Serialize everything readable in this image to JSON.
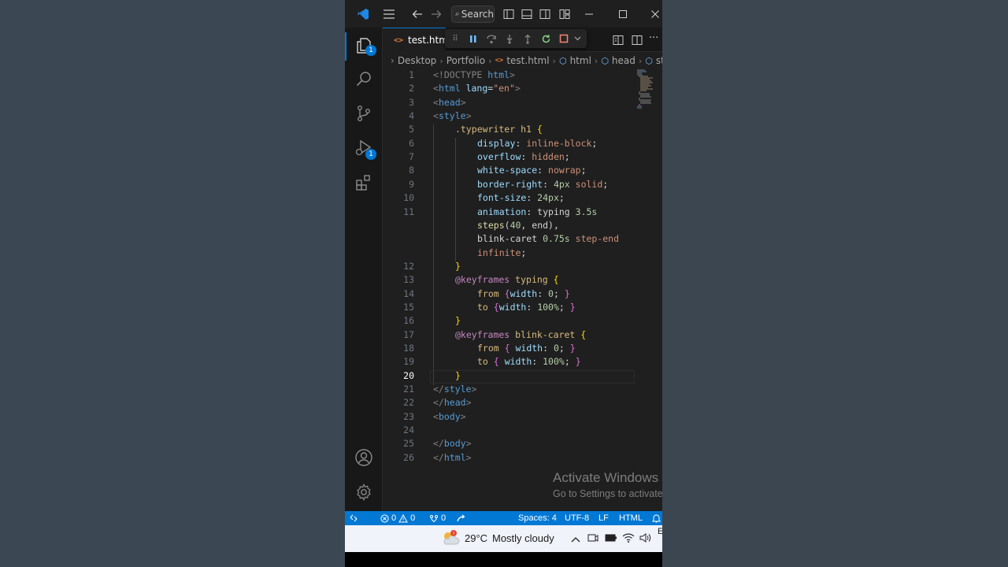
{
  "search": {
    "label": "Search"
  },
  "tab": {
    "title": "test.html"
  },
  "breadcrumb": [
    "Desktop",
    "Portfolio",
    "test.html",
    "html",
    "head",
    "style"
  ],
  "badges": {
    "explorer": "1",
    "debug": "1"
  },
  "editor": {
    "active_line": 20,
    "lines": [
      {
        "n": "1",
        "ind": 0,
        "tokens": [
          [
            "t-tag",
            "<!DOCTYPE "
          ],
          [
            "t-name",
            "html"
          ],
          [
            "t-tag",
            ">"
          ]
        ]
      },
      {
        "n": "2",
        "ind": 0,
        "tokens": [
          [
            "t-tag",
            "<"
          ],
          [
            "t-name",
            "html"
          ],
          [
            "t-attr",
            " lang"
          ],
          [
            "t-plain",
            "="
          ],
          [
            "t-str",
            "\"en\""
          ],
          [
            "t-tag",
            ">"
          ]
        ]
      },
      {
        "n": "3",
        "ind": 0,
        "tokens": [
          [
            "t-tag",
            "<"
          ],
          [
            "t-name",
            "head"
          ],
          [
            "t-tag",
            ">"
          ]
        ]
      },
      {
        "n": "4",
        "ind": 0,
        "tokens": [
          [
            "t-tag",
            "<"
          ],
          [
            "t-name",
            "style"
          ],
          [
            "t-tag",
            ">"
          ]
        ]
      },
      {
        "n": "5",
        "ind": 1,
        "tokens": [
          [
            "t-sel",
            ".typewriter h1 "
          ],
          [
            "t-brace1",
            "{"
          ]
        ]
      },
      {
        "n": "6",
        "ind": 2,
        "tokens": [
          [
            "t-prop",
            "display"
          ],
          [
            "t-plain",
            ": "
          ],
          [
            "t-val",
            "inline-block"
          ],
          [
            "t-plain",
            ";"
          ]
        ]
      },
      {
        "n": "7",
        "ind": 2,
        "tokens": [
          [
            "t-prop",
            "overflow"
          ],
          [
            "t-plain",
            ": "
          ],
          [
            "t-val",
            "hidden"
          ],
          [
            "t-plain",
            ";"
          ]
        ]
      },
      {
        "n": "8",
        "ind": 2,
        "tokens": [
          [
            "t-prop",
            "white-space"
          ],
          [
            "t-plain",
            ": "
          ],
          [
            "t-val",
            "nowrap"
          ],
          [
            "t-plain",
            ";"
          ]
        ]
      },
      {
        "n": "9",
        "ind": 2,
        "tokens": [
          [
            "t-prop",
            "border-right"
          ],
          [
            "t-plain",
            ": "
          ],
          [
            "t-num",
            "4px"
          ],
          [
            "t-val",
            " solid"
          ],
          [
            "t-plain",
            ";"
          ]
        ]
      },
      {
        "n": "10",
        "ind": 2,
        "tokens": [
          [
            "t-prop",
            "font-size"
          ],
          [
            "t-plain",
            ": "
          ],
          [
            "t-num",
            "24px"
          ],
          [
            "t-plain",
            ";"
          ]
        ]
      },
      {
        "n": "11",
        "ind": 2,
        "tokens": [
          [
            "t-prop",
            "animation"
          ],
          [
            "t-plain",
            ": "
          ],
          [
            "t-plain",
            "typing "
          ],
          [
            "t-num",
            "3.5s"
          ]
        ]
      },
      {
        "n": "",
        "ind": 2,
        "tokens": [
          [
            "t-kw",
            "steps"
          ],
          [
            "t-plain",
            "("
          ],
          [
            "t-num",
            "40"
          ],
          [
            "t-plain",
            ", end),"
          ]
        ]
      },
      {
        "n": "",
        "ind": 2,
        "tokens": [
          [
            "t-plain",
            "blink-caret "
          ],
          [
            "t-num",
            "0.75s"
          ],
          [
            "t-val",
            " step-end"
          ]
        ]
      },
      {
        "n": "",
        "ind": 2,
        "tokens": [
          [
            "t-val",
            "infinite"
          ],
          [
            "t-plain",
            ";"
          ]
        ]
      },
      {
        "n": "12",
        "ind": 1,
        "tokens": [
          [
            "t-brace1",
            "}"
          ]
        ]
      },
      {
        "n": "13",
        "ind": 1,
        "tokens": [
          [
            "t-at",
            "@keyframes"
          ],
          [
            "t-sel",
            " typing "
          ],
          [
            "t-brace1",
            "{"
          ]
        ]
      },
      {
        "n": "14",
        "ind": 2,
        "tokens": [
          [
            "t-sel",
            "from "
          ],
          [
            "t-brace2",
            "{"
          ],
          [
            "t-prop",
            "width"
          ],
          [
            "t-plain",
            ": "
          ],
          [
            "t-num",
            "0"
          ],
          [
            "t-plain",
            "; "
          ],
          [
            "t-brace2",
            "}"
          ]
        ]
      },
      {
        "n": "15",
        "ind": 2,
        "tokens": [
          [
            "t-sel",
            "to "
          ],
          [
            "t-brace2",
            "{"
          ],
          [
            "t-prop",
            "width"
          ],
          [
            "t-plain",
            ": "
          ],
          [
            "t-num",
            "100%"
          ],
          [
            "t-plain",
            "; "
          ],
          [
            "t-brace2",
            "}"
          ]
        ]
      },
      {
        "n": "16",
        "ind": 1,
        "tokens": [
          [
            "t-brace1",
            "}"
          ]
        ]
      },
      {
        "n": "17",
        "ind": 1,
        "tokens": [
          [
            "t-at",
            "@keyframes"
          ],
          [
            "t-sel",
            " blink-caret "
          ],
          [
            "t-brace1",
            "{"
          ]
        ]
      },
      {
        "n": "18",
        "ind": 2,
        "tokens": [
          [
            "t-sel",
            "from "
          ],
          [
            "t-brace2",
            "{"
          ],
          [
            "t-prop",
            " width"
          ],
          [
            "t-plain",
            ": "
          ],
          [
            "t-num",
            "0"
          ],
          [
            "t-plain",
            "; "
          ],
          [
            "t-brace2",
            "}"
          ]
        ]
      },
      {
        "n": "19",
        "ind": 2,
        "tokens": [
          [
            "t-sel",
            "to "
          ],
          [
            "t-brace2",
            "{"
          ],
          [
            "t-prop",
            " width"
          ],
          [
            "t-plain",
            ": "
          ],
          [
            "t-num",
            "100%"
          ],
          [
            "t-plain",
            "; "
          ],
          [
            "t-brace2",
            "}"
          ]
        ]
      },
      {
        "n": "20",
        "ind": 1,
        "tokens": [
          [
            "t-brace1",
            "}"
          ]
        ]
      },
      {
        "n": "21",
        "ind": 0,
        "tokens": [
          [
            "t-tag",
            "</"
          ],
          [
            "t-name",
            "style"
          ],
          [
            "t-tag",
            ">"
          ]
        ]
      },
      {
        "n": "22",
        "ind": 0,
        "tokens": [
          [
            "t-tag",
            "</"
          ],
          [
            "t-name",
            "head"
          ],
          [
            "t-tag",
            ">"
          ]
        ]
      },
      {
        "n": "23",
        "ind": 0,
        "tokens": [
          [
            "t-tag",
            "<"
          ],
          [
            "t-name",
            "body"
          ],
          [
            "t-tag",
            ">"
          ]
        ]
      },
      {
        "n": "24",
        "ind": 0,
        "tokens": []
      },
      {
        "n": "25",
        "ind": 0,
        "tokens": [
          [
            "t-tag",
            "</"
          ],
          [
            "t-name",
            "body"
          ],
          [
            "t-tag",
            ">"
          ]
        ]
      },
      {
        "n": "26",
        "ind": 0,
        "tokens": [
          [
            "t-tag",
            "</"
          ],
          [
            "t-name",
            "html"
          ],
          [
            "t-tag",
            ">"
          ]
        ]
      }
    ]
  },
  "watermark": {
    "line1": "Activate Windows",
    "line2": "Go to Settings to activate Windows."
  },
  "statusbar": {
    "errors": "0",
    "warnings": "0",
    "ports": "0",
    "spaces": "Spaces: 4",
    "encoding": "UTF-8",
    "eol": "LF",
    "language": "HTML"
  },
  "taskbar": {
    "temperature": "29°C",
    "weather": "Mostly cloudy"
  },
  "colors": {
    "accent": "#0078d4",
    "editor_bg": "#1f1f1f",
    "taskbar_bg": "#f0f3f9"
  }
}
